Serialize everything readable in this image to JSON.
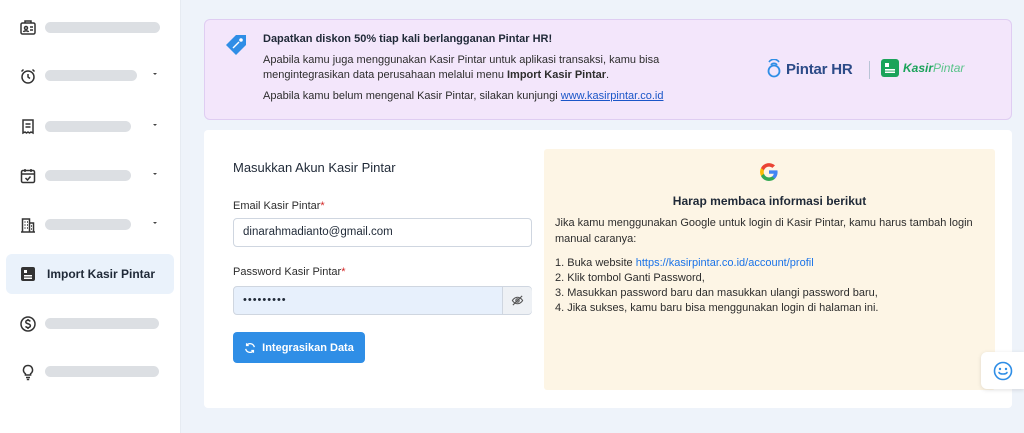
{
  "sidebar": {
    "items": [
      {
        "icon": "id-card-icon",
        "has_chevron": false
      },
      {
        "icon": "alarm-clock-icon",
        "has_chevron": true
      },
      {
        "icon": "receipt-icon",
        "has_chevron": true
      },
      {
        "icon": "calendar-check-icon",
        "has_chevron": true
      },
      {
        "icon": "building-icon",
        "has_chevron": true
      },
      {
        "icon": "import-icon",
        "label": "Import Kasir Pintar",
        "active": true
      },
      {
        "icon": "dollar-icon",
        "has_chevron": false
      },
      {
        "icon": "lightbulb-icon",
        "has_chevron": false
      }
    ]
  },
  "banner": {
    "title": "Dapatkan diskon 50% tiap kali berlangganan Pintar HR!",
    "p1_before": "Apabila kamu juga menggunakan Kasir Pintar untuk aplikasi transaksi, kamu bisa mengintegrasikan data perusahaan melalui menu ",
    "p1_bold": "Import Kasir Pintar",
    "p1_after": ".",
    "p2_before": "Apabila kamu belum mengenal Kasir Pintar, silakan kunjungi ",
    "p2_link": "www.kasirpintar.co.id",
    "logo_pintar_hr": "Pintar HR",
    "logo_kasir": "Kasir",
    "logo_pintar": "Pintar",
    "accent": "#2f8ee6",
    "kasir_green": "#1aa35a"
  },
  "form": {
    "title": "Masukkan Akun Kasir Pintar",
    "email_label": "Email Kasir Pintar",
    "email_value": "dinarahmadianto@gmail.com",
    "password_label": "Password Kasir Pintar",
    "password_value": "•••••••••",
    "required_mark": "*",
    "button_label": "Integrasikan Data"
  },
  "info": {
    "heading": "Harap membaca informasi berikut",
    "intro": "Jika kamu menggunakan Google untuk login di Kasir Pintar, kamu harus tambah login manual caranya:",
    "step1_before": "1. Buka website ",
    "step1_link": "https://kasirpintar.co.id/account/profil",
    "step2": "2. Klik tombol Ganti Password,",
    "step3": "3. Masukkan password baru dan masukkan ulangi password baru,",
    "step4": "4. Jika sukses, kamu baru bisa menggunakan login di halaman ini."
  }
}
